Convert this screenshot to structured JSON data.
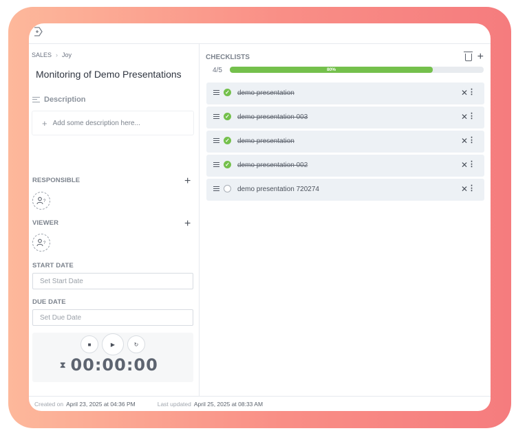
{
  "breadcrumb": {
    "section": "SALES",
    "current": "Joy"
  },
  "card": {
    "title": "Monitoring of Demo Presentations"
  },
  "description": {
    "heading": "Description",
    "placeholder": "Add some description here..."
  },
  "responsible": {
    "label": "RESPONSIBLE"
  },
  "viewer": {
    "label": "VIEWER"
  },
  "start_date": {
    "label": "START DATE",
    "placeholder": "Set Start Date"
  },
  "due_date": {
    "label": "DUE DATE",
    "placeholder": "Set Due Date"
  },
  "timer": {
    "display": "00:00:00"
  },
  "checklists": {
    "title": "CHECKLISTS",
    "count": "4/5",
    "progress_label": "80%",
    "progress_fraction": 0.8,
    "accent": "#74c04c",
    "items": [
      {
        "label": "demo presentation",
        "done": true
      },
      {
        "label": "demo presentation 003",
        "done": true
      },
      {
        "label": "demo presentation",
        "done": true
      },
      {
        "label": "demo presentation 002",
        "done": true
      },
      {
        "label": "demo presentation 720274",
        "done": false
      }
    ]
  },
  "footer": {
    "created_label": "Created on",
    "created_value": "April 23, 2025 at 04:36 PM",
    "updated_label": "Last updated",
    "updated_value": "April 25, 2025 at 08:33 AM"
  }
}
